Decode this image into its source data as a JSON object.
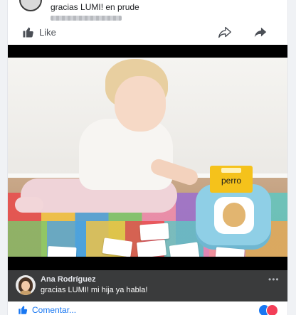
{
  "post": {
    "caption_snippet": "gracias LUMI! en prude"
  },
  "actions": {
    "like_label": "Like"
  },
  "video": {
    "card_word": "perro"
  },
  "comment": {
    "author": "Ana Rodríguez",
    "text": "gracias LUMI! mi hija ya habla!",
    "more": "•••"
  },
  "footer": {
    "comment_link": "Comentar..."
  },
  "colors": {
    "accent": "#1877f2",
    "like_reaction": "#1877f2",
    "love_reaction": "#f33e58",
    "comment_bar": "#3a3b3c"
  },
  "icons": {
    "like": "thumbs-up-icon",
    "share_outline": "share-outline-icon",
    "share_filled": "share-filled-icon",
    "comment": "thumbs-up-icon"
  }
}
